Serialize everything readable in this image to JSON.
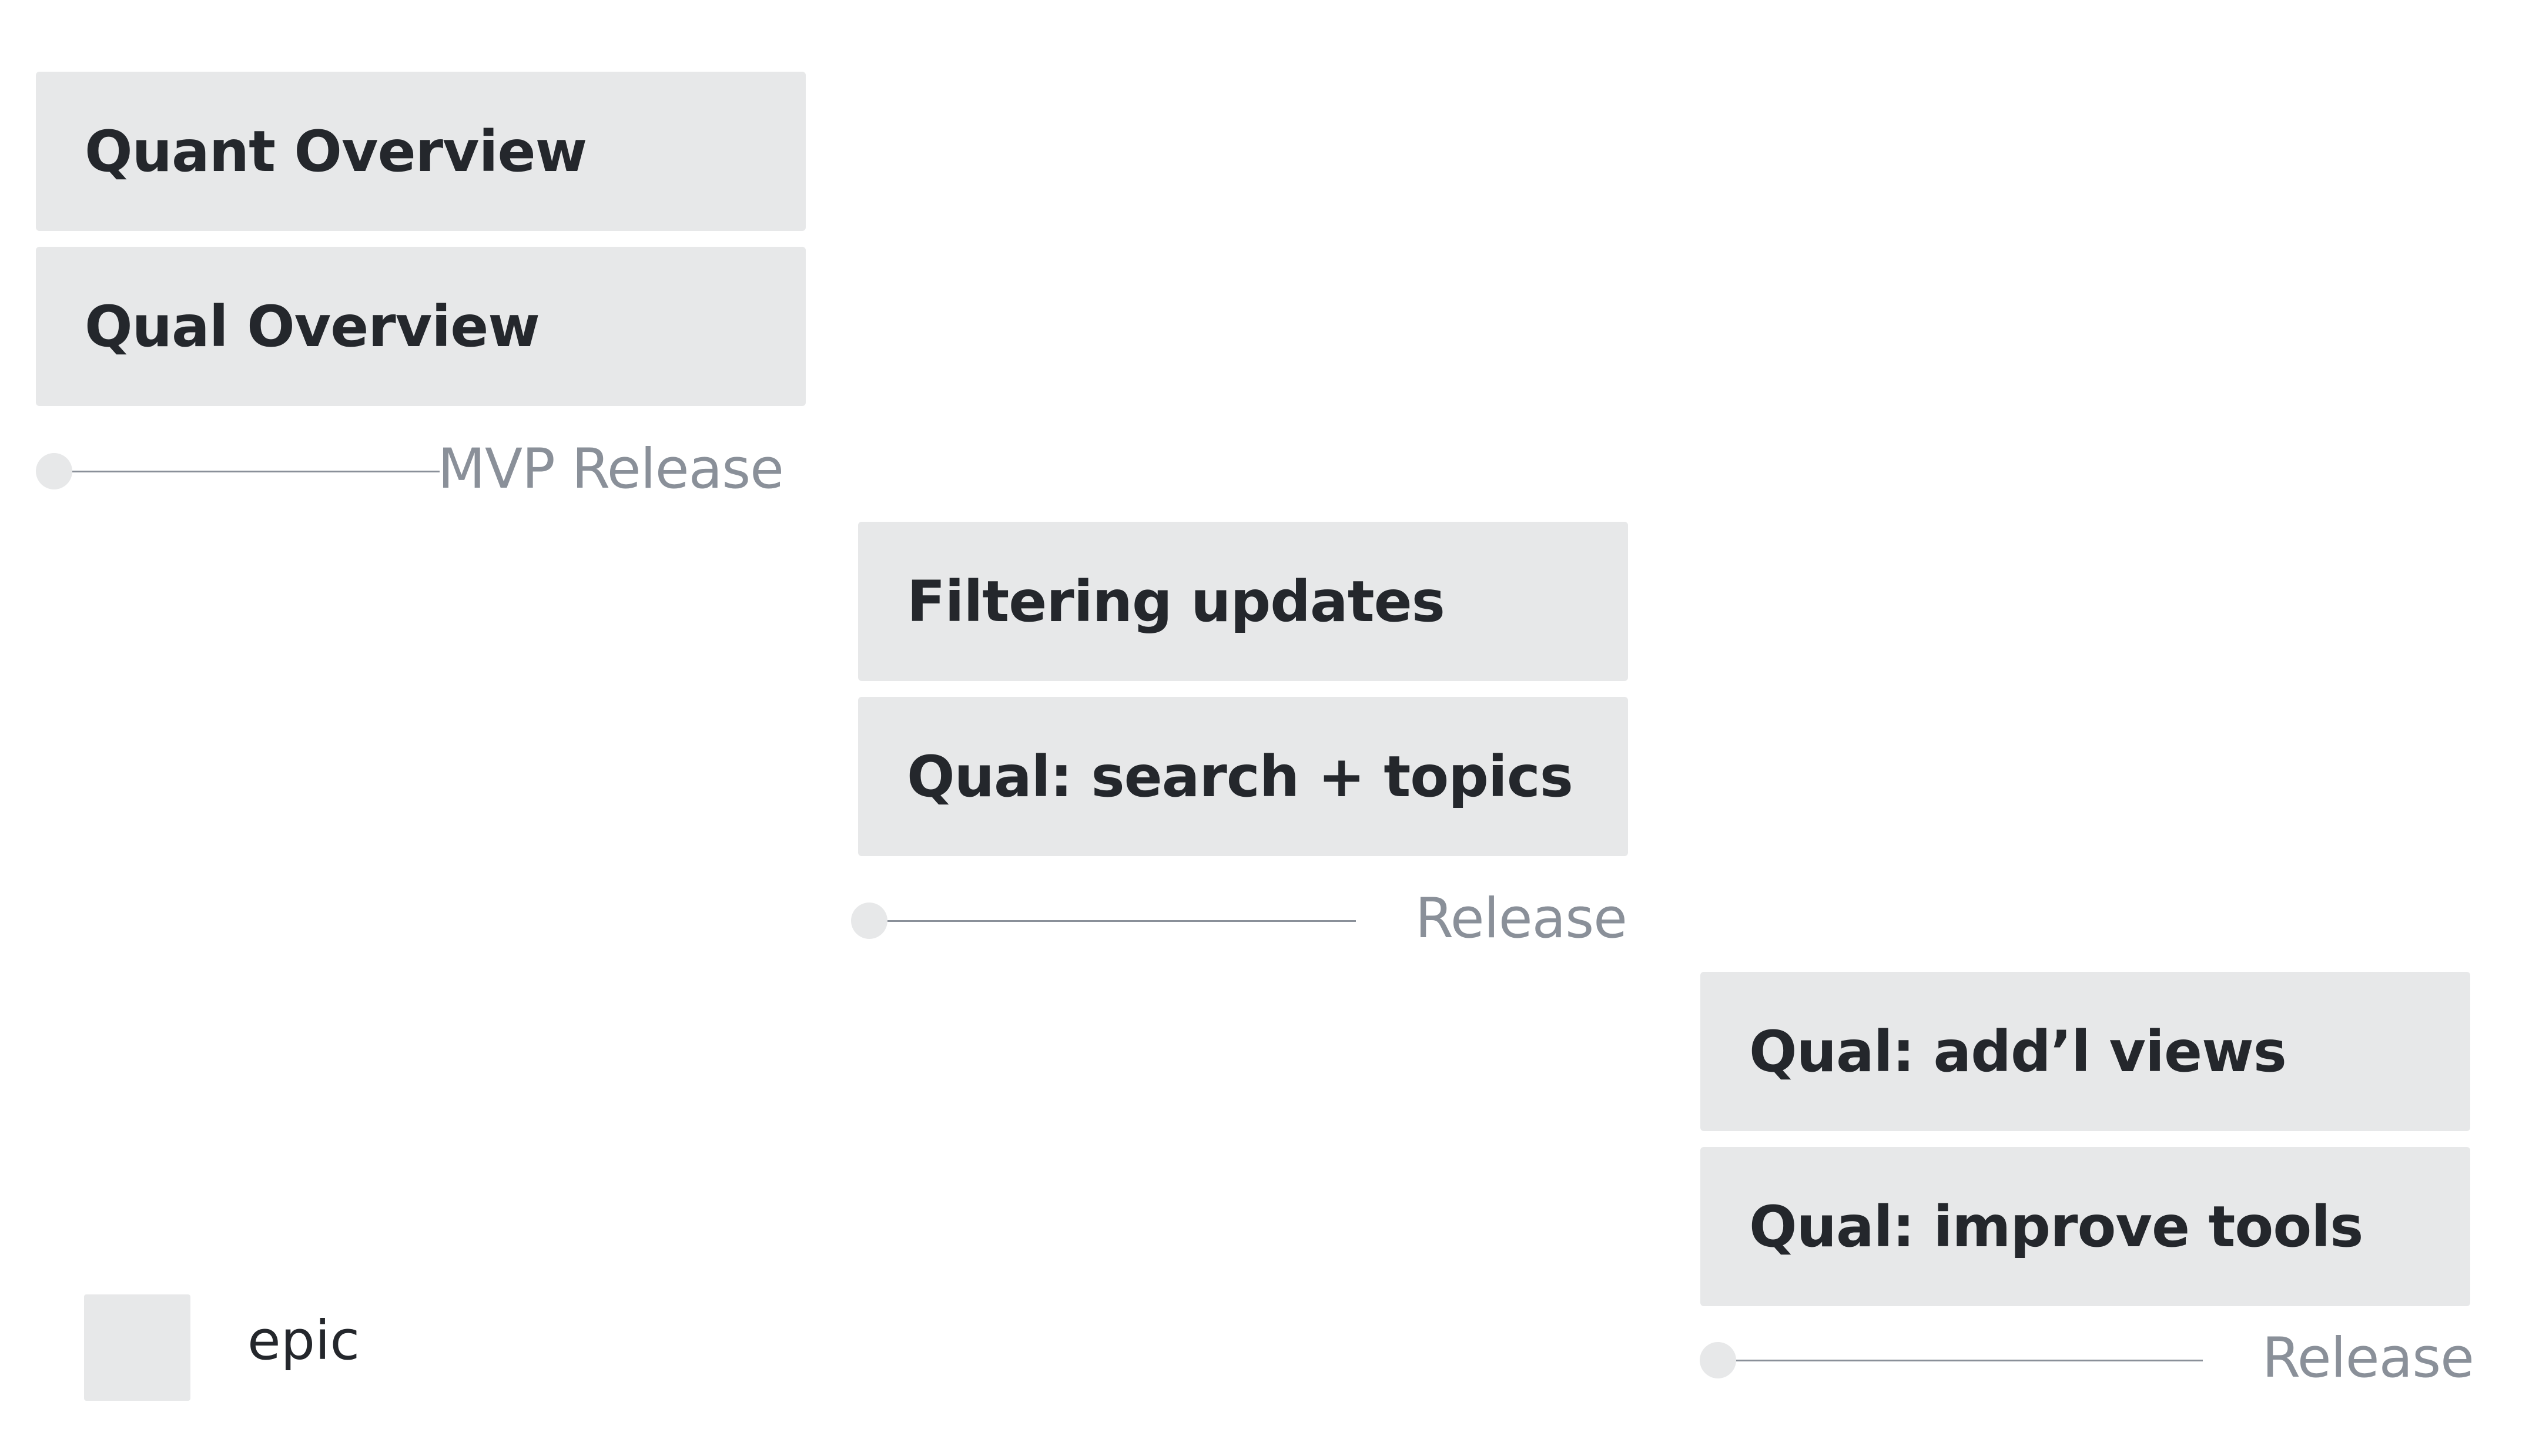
{
  "colors": {
    "epic_fill": "#e7e8e9",
    "epic_text": "#24272c",
    "release_text": "#8a9099",
    "background": "#ffffff"
  },
  "groups": [
    {
      "epics": [
        "Quant Overview",
        "Qual Overview"
      ],
      "release": "MVP Release"
    },
    {
      "epics": [
        "Filtering updates",
        "Qual: search + topics"
      ],
      "release": "Release"
    },
    {
      "epics": [
        "Qual: add’l views",
        "Qual: improve tools"
      ],
      "release": "Release"
    }
  ],
  "legend": {
    "label": "epic"
  }
}
